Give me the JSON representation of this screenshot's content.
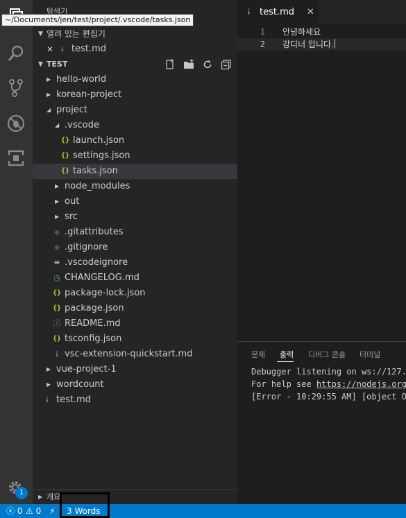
{
  "tooltip": "~/Documents/jen/test/project/.vscode/tasks.json",
  "sidebar": {
    "title": "탐색기",
    "open_editors": {
      "header": "열려 있는 편집기",
      "items": [
        {
          "label": "test.md"
        }
      ]
    },
    "workspace": {
      "header": "TEST",
      "tree": [
        {
          "label": "hello-world"
        },
        {
          "label": "korean-project"
        },
        {
          "label": "project"
        },
        {
          "label": ".vscode"
        },
        {
          "label": "launch.json"
        },
        {
          "label": "settings.json"
        },
        {
          "label": "tasks.json"
        },
        {
          "label": "node_modules"
        },
        {
          "label": "out"
        },
        {
          "label": "src"
        },
        {
          "label": ".gitattributes"
        },
        {
          "label": ".gitignore"
        },
        {
          "label": ".vscodeignore"
        },
        {
          "label": "CHANGELOG.md"
        },
        {
          "label": "package-lock.json"
        },
        {
          "label": "package.json"
        },
        {
          "label": "README.md"
        },
        {
          "label": "tsconfig.json"
        },
        {
          "label": "vsc-extension-quickstart.md"
        },
        {
          "label": "vue-project-1"
        },
        {
          "label": "wordcount"
        },
        {
          "label": "test.md"
        }
      ]
    },
    "outline_header": "개요"
  },
  "editor": {
    "tab": {
      "label": "test.md",
      "close": "✕"
    },
    "lines": [
      {
        "number": "1",
        "text": "안녕하세요"
      },
      {
        "number": "2",
        "text": "강디너 입니다."
      }
    ]
  },
  "panel": {
    "tabs": [
      "문제",
      "출력",
      "디버그 콘솔",
      "터미널"
    ],
    "active_tab": "출력",
    "output": {
      "line1": "Debugger listening on ws://127.",
      "line2_prefix": "For help see ",
      "line2_link": "https://nodejs.org",
      "line3": "[Error - 10:29:55 AM] [object O"
    }
  },
  "status_bar": {
    "errors": "0",
    "warnings": "0",
    "words": "3 Words"
  },
  "activity_bar": {
    "settings_badge": "1"
  },
  "colors": {
    "accent": "#007acc",
    "json_icon": "#cbcb41",
    "md_icon": "#519aba"
  }
}
